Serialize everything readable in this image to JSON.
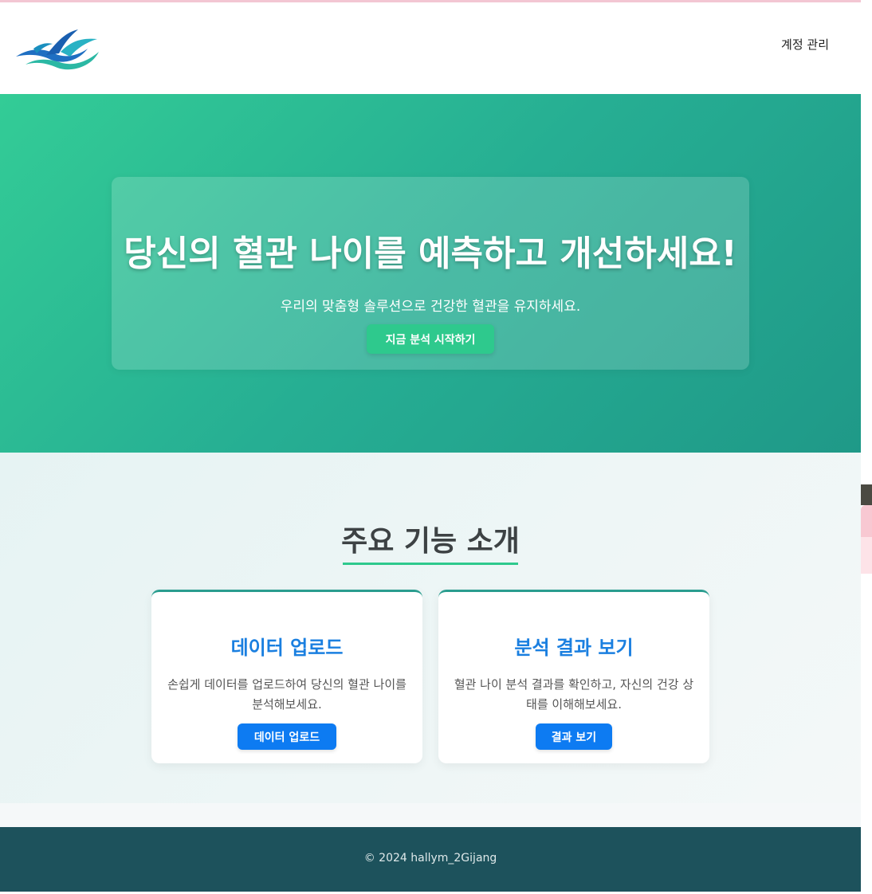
{
  "colors": {
    "hero_gradient_start": "#33cc96",
    "hero_gradient_end": "#1f9988",
    "primary_green": "#2ec98d",
    "card_accent": "#2a9d8f",
    "link_blue": "#1a7fe0",
    "button_blue": "#0d7bf2",
    "footer_bg": "#1d525c"
  },
  "header": {
    "logo_icon": "wave-logo-icon",
    "account_link": "계정 관리"
  },
  "hero": {
    "title": "당신의 혈관 나이를 예측하고 개선하세요!",
    "subtitle": "우리의 맞춤형 솔루션으로 건강한 혈관을 유지하세요.",
    "cta_label": "지금 분석 시작하기"
  },
  "features": {
    "title": "주요 기능 소개",
    "cards": [
      {
        "title": "데이터 업로드",
        "description": "손쉽게 데이터를 업로드하여 당신의 혈관 나이를 분석해보세요.",
        "button_label": "데이터 업로드"
      },
      {
        "title": "분석 결과 보기",
        "description": "혈관 나이 분석 결과를 확인하고, 자신의 건강 상태를 이해해보세요.",
        "button_label": "결과 보기"
      }
    ]
  },
  "footer": {
    "copyright": "© 2024 hallym_2Gijang"
  }
}
